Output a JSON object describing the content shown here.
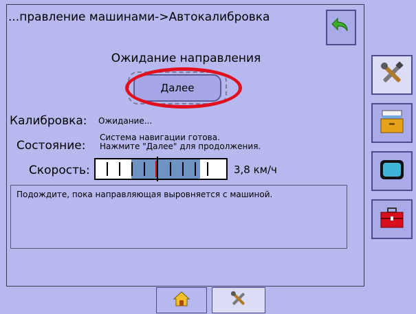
{
  "header": {
    "title": "...правление машинами->Автокалибровка",
    "back_icon": "back-arrow-icon"
  },
  "status": {
    "waiting_direction": "Ожидание направления",
    "next_button": "Далее"
  },
  "calibration": {
    "label": "Калибровка:",
    "value": "Ожидание..."
  },
  "state": {
    "label": "Состояние:",
    "line1": "Система навигации готова.",
    "line2": "Нажмите \"Далее\" для продолжения."
  },
  "speed": {
    "label": "Скорость:",
    "value": "3,8 км/ч"
  },
  "message": {
    "text": "Подождите, пока направляющая выровняется с машиной."
  },
  "sidebar": {
    "items": [
      {
        "icon": "tools-icon",
        "active": true
      },
      {
        "icon": "file-cabinet-icon",
        "active": false
      },
      {
        "icon": "display-icon",
        "active": false
      },
      {
        "icon": "toolbox-icon",
        "active": false
      }
    ]
  },
  "bottom_tabs": [
    {
      "icon": "home-icon",
      "active": false
    },
    {
      "icon": "tools-icon",
      "active": true
    }
  ],
  "colors": {
    "background": "#b6b8ee",
    "highlight": "#e0101e",
    "speed_fill": "#6f94c4"
  }
}
